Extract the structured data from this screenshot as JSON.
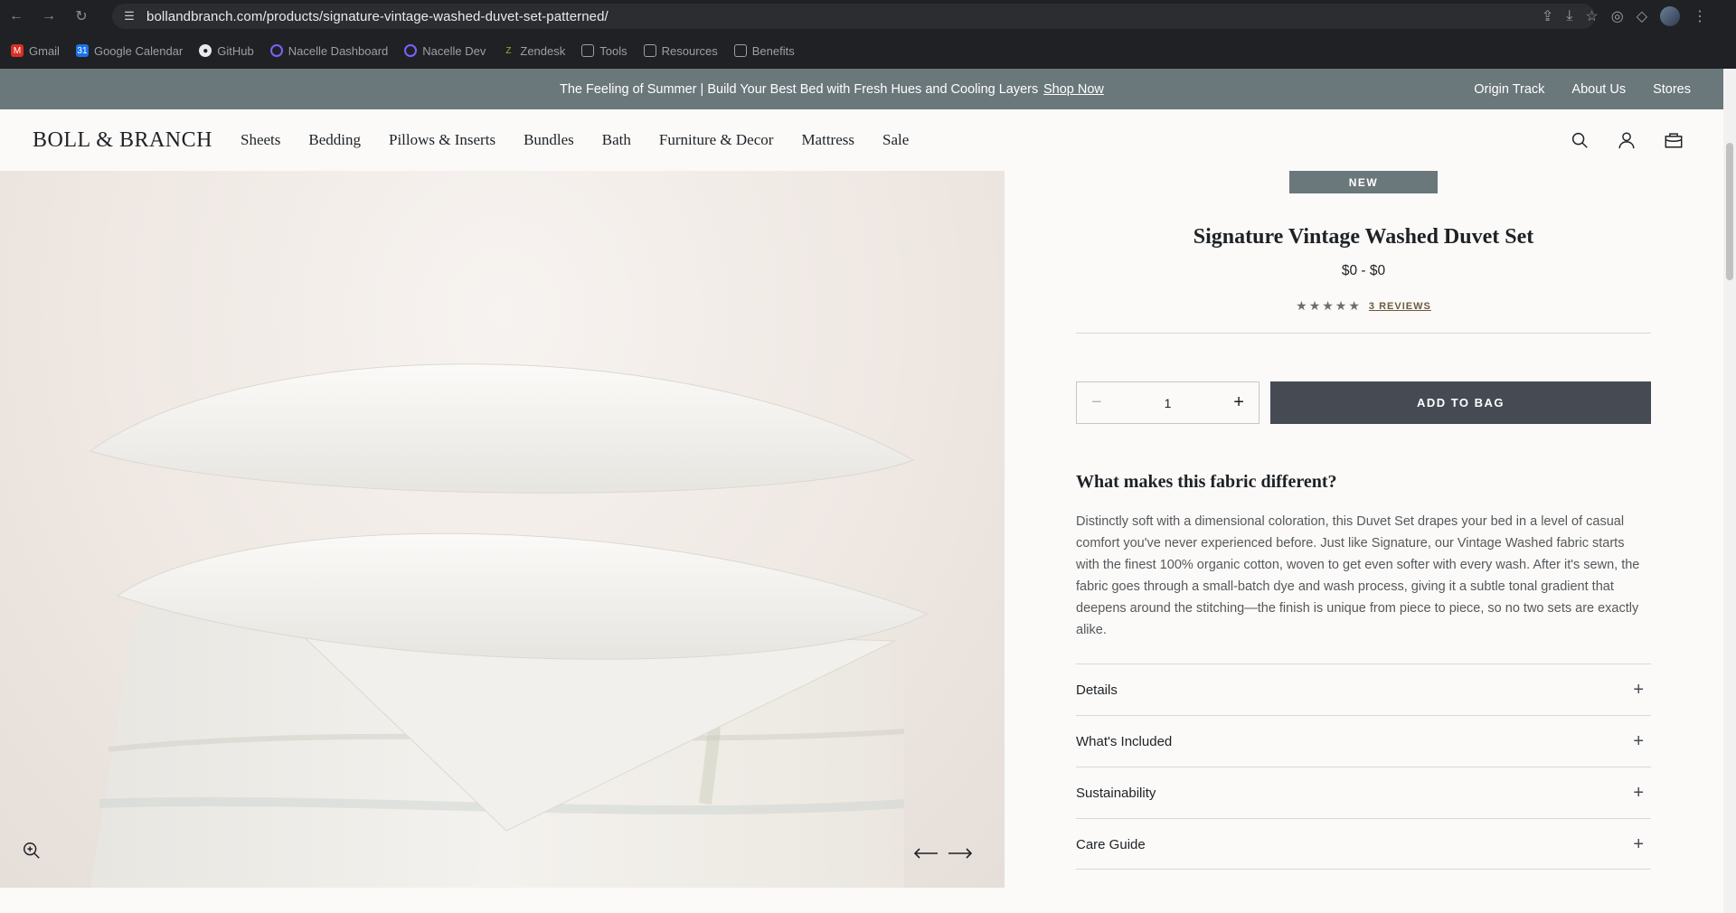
{
  "browser": {
    "url": "bollandbranch.com/products/signature-vintage-washed-duvet-set-patterned/",
    "bookmarks": [
      "Gmail",
      "Google Calendar",
      "GitHub",
      "Nacelle Dashboard",
      "Nacelle Dev",
      "Zendesk",
      "Tools",
      "Resources",
      "Benefits"
    ]
  },
  "promo": {
    "text": "The Feeling of Summer | Build Your Best Bed with Fresh Hues and Cooling Layers",
    "link": "Shop Now",
    "right_links": [
      "Origin Track",
      "About Us",
      "Stores"
    ]
  },
  "header": {
    "logo": "BOLL & BRANCH",
    "nav": [
      "Sheets",
      "Bedding",
      "Pillows & Inserts",
      "Bundles",
      "Bath",
      "Furniture & Decor",
      "Mattress",
      "Sale"
    ]
  },
  "product": {
    "badge": "NEW",
    "title": "Signature Vintage Washed Duvet Set",
    "price": "$0 - $0",
    "rating": 5,
    "stars": "★★★★★",
    "reviews_label": "3 REVIEWS",
    "quantity": "1",
    "minus": "−",
    "plus": "+",
    "add_to_bag": "ADD TO BAG",
    "fabric_title": "What makes this fabric different?",
    "fabric_body": "Distinctly soft with a dimensional coloration, this Duvet Set drapes your bed in a level of casual comfort you've never experienced before. Just like Signature, our Vintage Washed fabric starts with the finest 100% organic cotton, woven to get even softer with every wash. After it's sewn, the fabric goes through a small-batch dye and wash process, giving it a subtle tonal gradient that deepens around the stitching—the finish is unique from piece to piece, so no two sets are exactly alike.",
    "accordions": [
      "Details",
      "What's Included",
      "Sustainability",
      "Care Guide"
    ],
    "accordion_icon": "+"
  },
  "colors": {
    "promo_bg": "#6a777b",
    "button_bg": "#454a53",
    "text": "#1e2126"
  }
}
